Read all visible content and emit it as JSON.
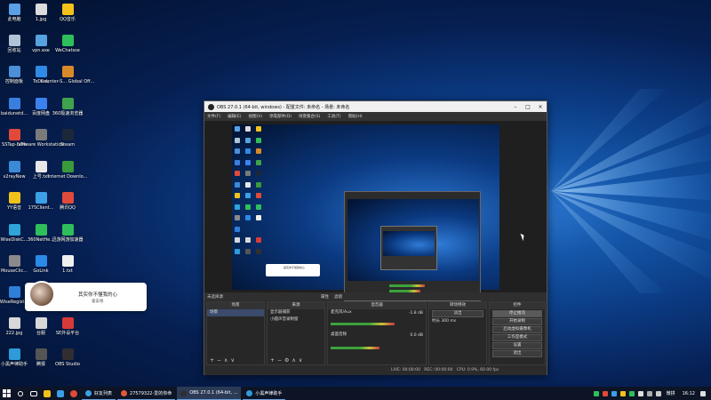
{
  "desktop": {
    "icons_col1": [
      {
        "label": "此电脑",
        "color": "#5aa0e6"
      },
      {
        "label": "回收站",
        "color": "#b0c4d8"
      },
      {
        "label": "控制面板",
        "color": "#4b8fd6"
      },
      {
        "label": "baidunetd...",
        "color": "#3a7fe0"
      },
      {
        "label": "SSTap-beta",
        "color": "#e04a3a"
      },
      {
        "label": "v2rayNew",
        "color": "#3a8ad6"
      },
      {
        "label": "YY语音",
        "color": "#f2c21b"
      },
      {
        "label": "WiseDiskC...",
        "color": "#2fa4d8"
      },
      {
        "label": "MouseClic...",
        "color": "#8a8a8a"
      },
      {
        "label": "WiseRegist...",
        "color": "#2f7fd8"
      },
      {
        "label": "222.jpg",
        "color": "#d8d8d8"
      },
      {
        "label": "小黑声律助手",
        "color": "#2f9ad8"
      }
    ],
    "icons_col2": [
      {
        "label": "1.jpg",
        "color": "#dcdcdc"
      },
      {
        "label": "vpn.exe",
        "color": "#56a3e0"
      },
      {
        "label": "ToDesk",
        "color": "#2f8be6"
      },
      {
        "label": "百度网盘",
        "color": "#3b82f0"
      },
      {
        "label": "VMware Workstation",
        "color": "#7a7a7a"
      },
      {
        "label": "上号.txt",
        "color": "#e8e8e8"
      },
      {
        "label": "175Client...",
        "color": "#3da0e6"
      },
      {
        "label": "360NetHe...",
        "color": "#2fbf5a"
      },
      {
        "label": "GoLink",
        "color": "#2a8ae6"
      },
      {
        "label": "",
        "color": ""
      },
      {
        "label": "台服",
        "color": "#d8d8d8"
      },
      {
        "label": "腾报",
        "color": "#555"
      }
    ],
    "icons_col3": [
      {
        "label": "QQ音乐",
        "color": "#f2c21b"
      },
      {
        "label": "WeChatsse",
        "color": "#2fbf5a"
      },
      {
        "label": "Counter-S... Global Off...",
        "color": "#d88a2a"
      },
      {
        "label": "360极速浏览器",
        "color": "#3fa34d"
      },
      {
        "label": "Steam",
        "color": "#1b2838"
      },
      {
        "label": "Internet Downlo...",
        "color": "#3a9a3a"
      },
      {
        "label": "腾讯QQ",
        "color": "#e04a3a"
      },
      {
        "label": "迅游网游加速器",
        "color": "#2fbf5a"
      },
      {
        "label": "1.txt",
        "color": "#f0f0f0"
      },
      {
        "label": "",
        "color": ""
      },
      {
        "label": "SE外设平台",
        "color": "#d83a3a"
      },
      {
        "label": "OBS Studio",
        "color": "#302e31"
      }
    ]
  },
  "notification": {
    "title": "其实你不懂我的心",
    "subtitle": "童安格"
  },
  "obs": {
    "title": "OBS 27.0.1 (64-bit, windows) - 配置文件: 未命名 - 场景: 未命名",
    "menu": [
      "文件(F)",
      "编辑(E)",
      "视图(V)",
      "停靠部件(D)",
      "场景集合(S)",
      "工具(T)",
      "帮助(H)"
    ],
    "scene_bar": {
      "label": "未选择源",
      "props": "属性",
      "filters": "滤镜"
    },
    "docks": {
      "scenes": {
        "title": "场景",
        "items": [
          "场景"
        ]
      },
      "sources": {
        "title": "来源",
        "items": [
          "显示器捕获",
          "小圆声音录制窗"
        ]
      },
      "mixer": {
        "title": "混音器",
        "tracks": [
          {
            "name": "麦克风/Aux",
            "db": "-1.8 dB",
            "level": 0.72
          },
          {
            "name": "桌面音频",
            "db": "0.0 dB",
            "level": 0.55
          }
        ]
      },
      "transitions": {
        "title": "转场特效",
        "type": "淡出",
        "duration_label": "时长",
        "duration": "300 ms"
      },
      "controls": {
        "title": "控件",
        "buttons": [
          "停止推流",
          "开始录制",
          "启动虚拟摄像机",
          "工作室模式",
          "设置",
          "退出"
        ]
      }
    },
    "status": {
      "live": "LIVE: 00:00:00",
      "rec": "REC: 00:00:00",
      "cpu": "CPU: 0.9%, 60.00 fps"
    }
  },
  "taskbar": {
    "apps": [
      {
        "label": "好友列表",
        "color": "#3aa0e6",
        "active": false
      },
      {
        "label": "27579322-爱的你命",
        "color": "#e05a3a",
        "active": false
      },
      {
        "label": "OBS 27.0.1 (64-bit, ...",
        "color": "#302e31",
        "active": true
      },
      {
        "label": "小黑声律助手",
        "color": "#2f9ad8",
        "active": false
      }
    ],
    "lang": "微拼",
    "time": "16:12"
  }
}
